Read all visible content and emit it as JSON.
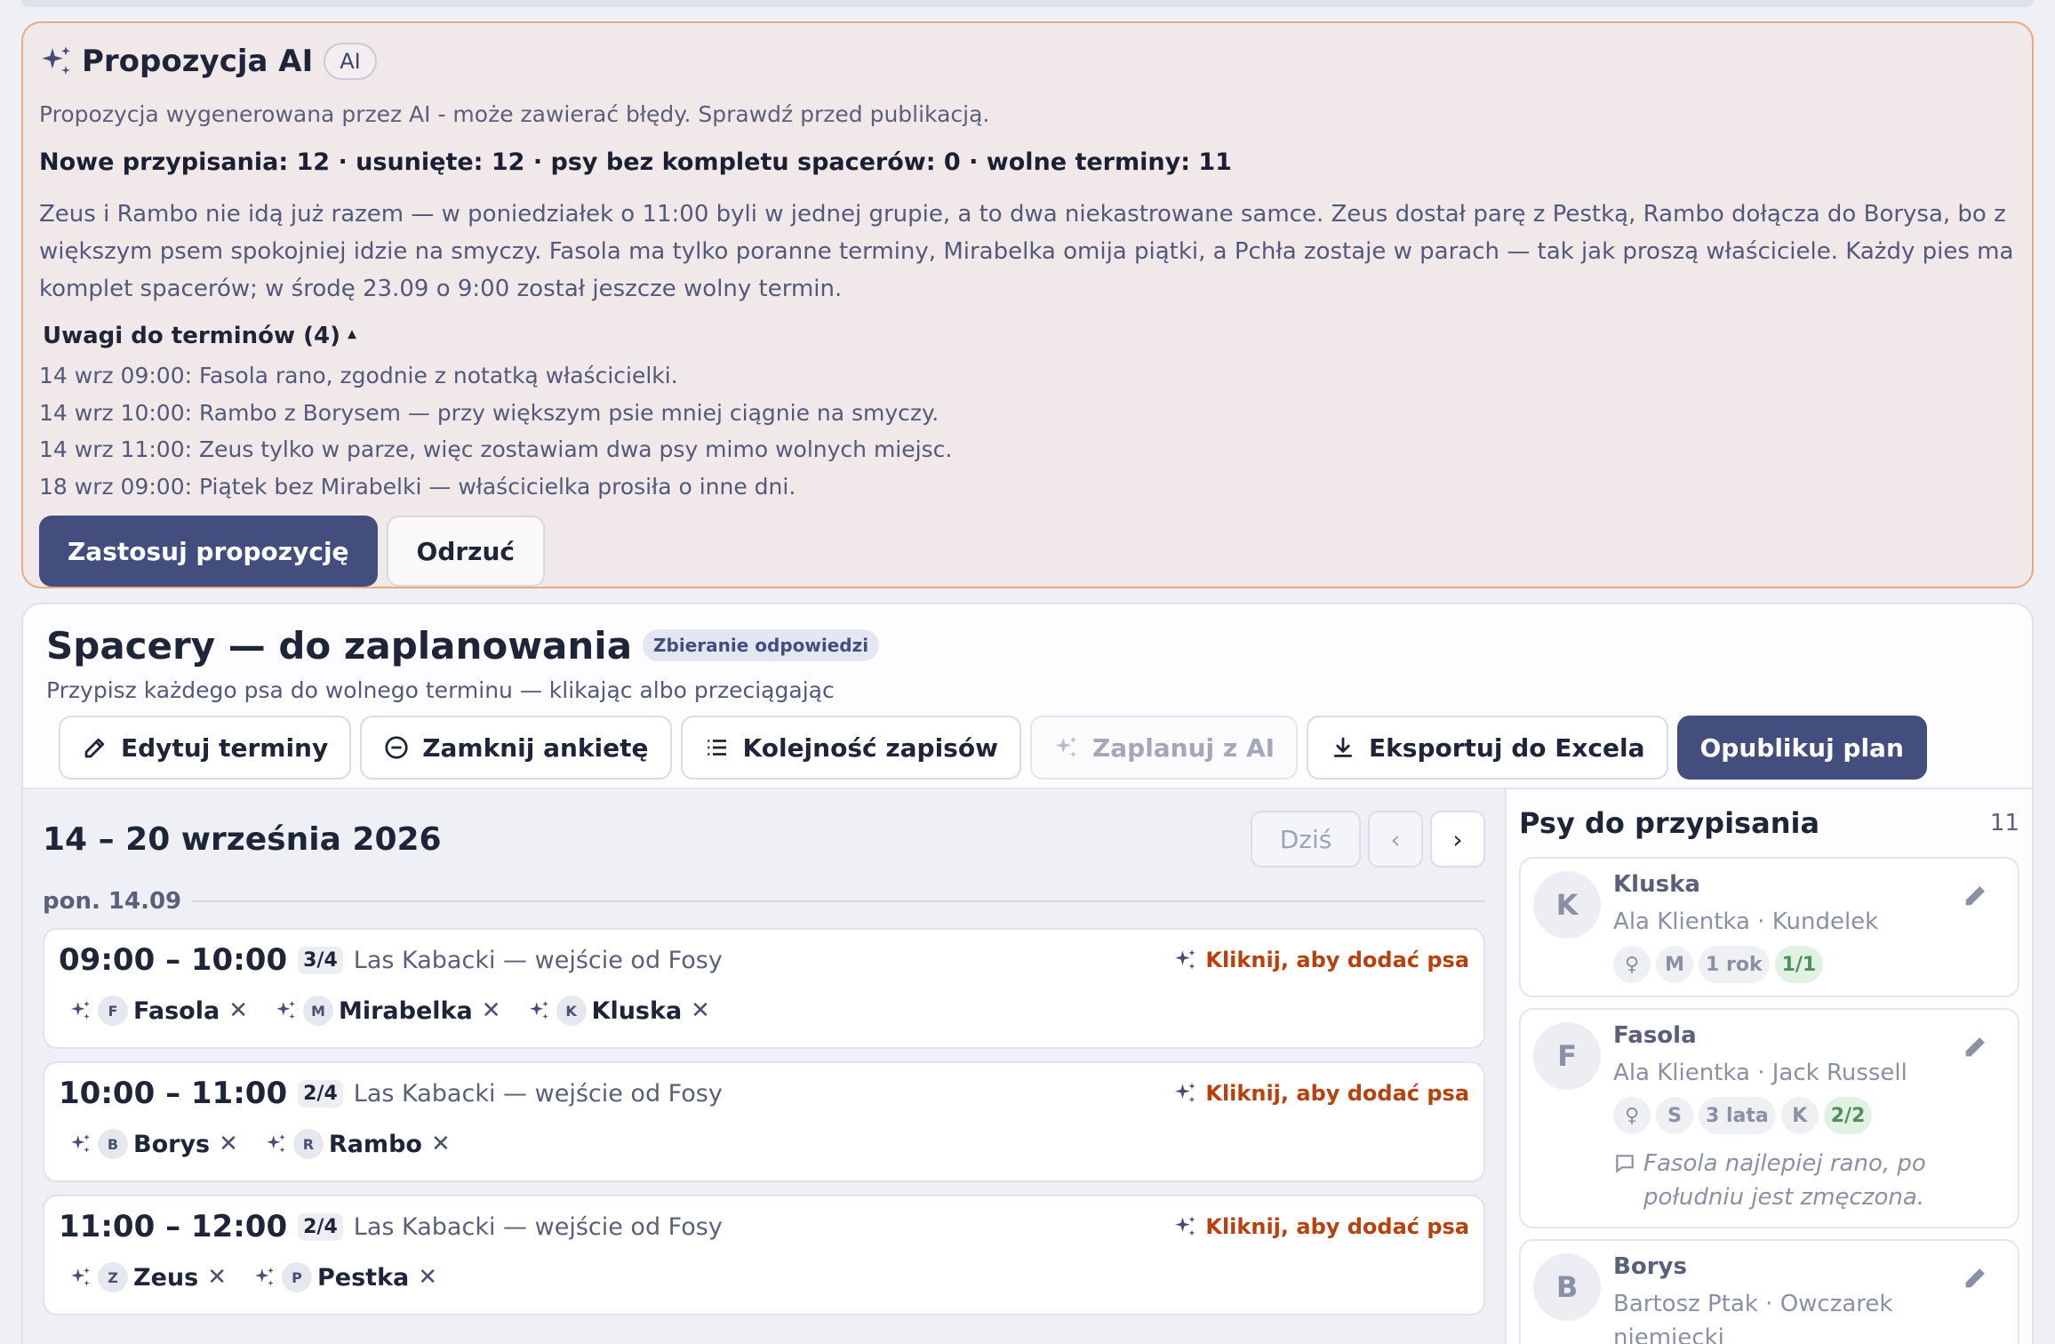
{
  "ai": {
    "title": "Propozycja AI",
    "pill": "AI",
    "subtitle": "Propozycja wygenerowana przez AI - może zawierać błędy. Sprawdź przed publikacją.",
    "stats": "Nowe przypisania: 12 · usunięte: 12 · psy bez kompletu spacerów: 0 · wolne terminy: 11",
    "paragraph": "Zeus i Rambo nie idą już razem — w poniedziałek o 11:00 byli w jednej grupie, a to dwa niekastrowane samce. Zeus dostał parę z Pestką, Rambo dołącza do Borysa, bo z większym psem spokojniej idzie na smyczy. Fasola ma tylko poranne terminy, Mirabelka omija piątki, a Pchła zostaje w parach — tak jak proszą właściciele. Każdy pies ma komplet spacerów; w środę 23.09 o 9:00 został jeszcze wolny termin.",
    "notes_toggle": "Uwagi do terminów (4)",
    "notes": [
      "14 wrz 09:00: Fasola rano, zgodnie z notatką właścicielki.",
      "14 wrz 10:00: Rambo z Borysem — przy większym psie mniej ciągnie na smyczy.",
      "14 wrz 11:00: Zeus tylko w parze, więc zostawiam dwa psy mimo wolnych miejsc.",
      "18 wrz 09:00: Piątek bez Mirabelki — właścicielka prosiła o inne dni."
    ],
    "apply_label": "Zastosuj propozycję",
    "reject_label": "Odrzuć"
  },
  "plan": {
    "title": "Spacery — do zaplanowania",
    "status": "Zbieranie odpowiedzi",
    "subtitle": "Przypisz każdego psa do wolnego terminu — klikając albo przeciągając",
    "toolbar": {
      "edit": "Edytuj terminy",
      "close": "Zamknij ankietę",
      "order": "Kolejność zapisów",
      "ai": "Zaplanuj z AI",
      "export": "Eksportuj do Excela",
      "publish": "Opublikuj plan"
    }
  },
  "schedule": {
    "week": "14 – 20 września 2026",
    "today": "Dziś",
    "day": "pon. 14.09",
    "add_label": "Kliknij, aby dodać psa",
    "slots": [
      {
        "time": "09:00 – 10:00",
        "count": "3/4",
        "location": "Las Kabacki — wejście od Fosy",
        "dogs": [
          {
            "initial": "F",
            "name": "Fasola"
          },
          {
            "initial": "M",
            "name": "Mirabelka"
          },
          {
            "initial": "K",
            "name": "Kluska"
          }
        ]
      },
      {
        "time": "10:00 – 11:00",
        "count": "2/4",
        "location": "Las Kabacki — wejście od Fosy",
        "dogs": [
          {
            "initial": "B",
            "name": "Borys"
          },
          {
            "initial": "R",
            "name": "Rambo"
          }
        ]
      },
      {
        "time": "11:00 – 12:00",
        "count": "2/4",
        "location": "Las Kabacki — wejście od Fosy",
        "dogs": [
          {
            "initial": "Z",
            "name": "Zeus"
          },
          {
            "initial": "P",
            "name": "Pestka"
          }
        ]
      }
    ]
  },
  "sidebar": {
    "title": "Psy do przypisania",
    "count": "11",
    "dogs": [
      {
        "initial": "K",
        "name": "Kluska",
        "meta": "Ala Klientka · Kundelek",
        "sex": "♀",
        "size": "M",
        "age": "1 rok",
        "extra": "",
        "walks": "1/1",
        "note": ""
      },
      {
        "initial": "F",
        "name": "Fasola",
        "meta": "Ala Klientka · Jack Russell",
        "sex": "♀",
        "size": "S",
        "age": "3 lata",
        "extra": "K",
        "walks": "2/2",
        "note": "Fasola najlepiej rano, po południu jest zmęczona."
      },
      {
        "initial": "B",
        "name": "Borys",
        "meta": "Bartosz Ptak · Owczarek niemiecki",
        "sex": "",
        "size": "",
        "age": "",
        "extra": "",
        "walks": "",
        "note": ""
      }
    ]
  },
  "colors": {
    "accent": "#434e7e",
    "ai_border": "#ecaa7c",
    "add_link": "#b8410e"
  }
}
